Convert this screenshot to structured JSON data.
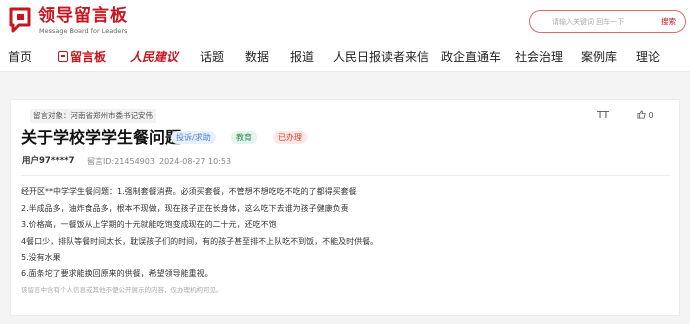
{
  "header": {
    "brand_cn": "领导留言板",
    "brand_en": "Message Board for Leaders",
    "search": {
      "placeholder": "请输入关键词 回车一下",
      "button_label": "搜索"
    }
  },
  "nav": {
    "items": [
      {
        "label": "首页"
      },
      {
        "label": "留言板"
      },
      {
        "label": "人民建议"
      },
      {
        "label": "话题"
      },
      {
        "label": "数据"
      },
      {
        "label": "报道"
      },
      {
        "label": "人民日报读者来信"
      },
      {
        "label": "政企直通车"
      },
      {
        "label": "社会治理"
      },
      {
        "label": "案例库"
      },
      {
        "label": "理论"
      }
    ]
  },
  "message": {
    "target": "留言对象：河南省郑州市委书记安伟",
    "title": "关于学校学学生餐问题",
    "tags": [
      "投诉/求助",
      "教育",
      "已办理"
    ],
    "user": "用户97****7",
    "message_id": "留言ID:21454903",
    "time": "2024-08-27 10:53",
    "font_tool": "TT",
    "likes": "0",
    "body_lines": [
      "经开区**中学学生餐问题：1.强制套餐消费。必须买套餐，不管想不想吃吃不吃的了都得买套餐",
      "2.半成品多，油炸食品多，根本不现做，现在孩子正在长身体，这么吃下去谁为孩子健康负责",
      "3.价格高，一餐饭从上学期的十元就能吃饱变成现在的二十元，还吃不饱",
      "4餐口少，排队等餐时间太长，耽误孩子们的时间，有的孩子甚至排不上队吃不到饭，不能及时供餐。",
      "5.没有水果",
      "6.面条坨了要求能换回原来的供餐，希望领导能重视。"
    ],
    "footnote": "该留言中含有个人信息或其他不便公开展示的内容，仅办理机构可见。"
  },
  "colors": {
    "brand_red": "#c9151e",
    "tag_blue": "#4a7fc9",
    "tag_green": "#2e8b57",
    "tag_red": "#d9432f"
  }
}
